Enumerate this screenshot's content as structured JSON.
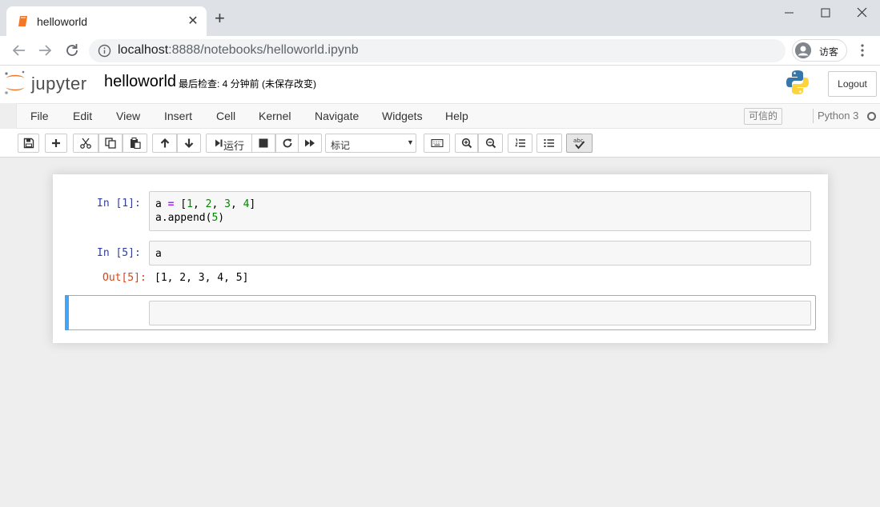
{
  "browser": {
    "tab_title": "helloworld",
    "url_host": "localhost",
    "url_path": ":8888/notebooks/helloworld.ipynb",
    "profile_label": "访客"
  },
  "jupyter": {
    "logo_text": "jupyter",
    "notebook_name": "helloworld",
    "checkpoint_status": "最后检查: 4 分钟前  (未保存改变)",
    "logout_label": "Logout"
  },
  "menu": {
    "items": [
      "File",
      "Edit",
      "View",
      "Insert",
      "Cell",
      "Kernel",
      "Navigate",
      "Widgets",
      "Help"
    ],
    "trusted_label": "可信的",
    "kernel_name": "Python 3"
  },
  "toolbar": {
    "run_label": "运行",
    "cell_type": "标记"
  },
  "cells": [
    {
      "prompt": "In  [1]:",
      "code_lines": [
        "a = [1, 2, 3, 4]",
        "a.append(5)"
      ]
    },
    {
      "prompt": "In  [5]:",
      "code_lines": [
        "a"
      ],
      "output_prompt": "Out[5]:",
      "output": "[1, 2, 3, 4, 5]"
    },
    {
      "prompt": "",
      "code_lines": [],
      "selected": true
    }
  ],
  "colors": {
    "prompt_in": "#303f9f",
    "prompt_out": "#d84315",
    "selected_bar": "#42a5f5",
    "jupyter_orange": "#f37726"
  }
}
